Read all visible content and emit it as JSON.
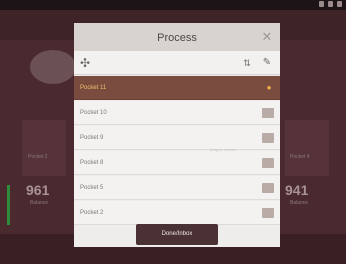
{
  "dialog": {
    "title": "Process",
    "footer_button_label": "Done/Inbox",
    "gesture_hint": "drag to reorder"
  },
  "list": {
    "items": [
      {
        "label": "Pocket 11",
        "selected": true,
        "indicator": "eye-icon"
      },
      {
        "label": "Pocket 10",
        "selected": false,
        "indicator": "square"
      },
      {
        "label": "Pocket 9",
        "selected": false,
        "indicator": "square"
      },
      {
        "label": "Pocket 8",
        "selected": false,
        "indicator": "square"
      },
      {
        "label": "Pocket 5",
        "selected": false,
        "indicator": "square"
      },
      {
        "label": "Pocket 2",
        "selected": false,
        "indicator": "square"
      }
    ]
  },
  "background": {
    "stat_left_label": "Pocket 2",
    "stat_left_value": "961",
    "stat_right_value": "941",
    "stat_right_label": "Pocket 4",
    "sub_left": "Balance",
    "sub_right": "Balance"
  },
  "colors": {
    "selected_row": "#7a4b3f",
    "selected_text": "#f1c26a",
    "dialog_bg": "#efedeb",
    "footer_button": "#4a3134",
    "backdrop": "#4a2a2e"
  }
}
